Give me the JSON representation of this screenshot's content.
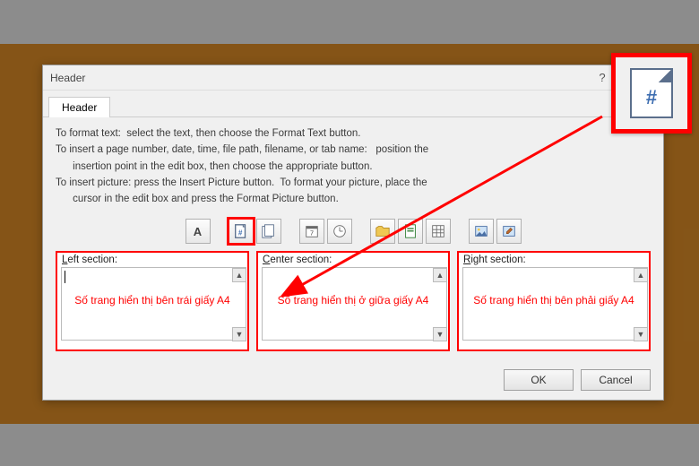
{
  "dialog": {
    "title": "Header",
    "tab": "Header",
    "help": "?",
    "close": "✕",
    "instructions": {
      "l1": "To format text:  select the text, then choose the Format Text button.",
      "l2": "To insert a page number, date, time, file path, filename, or tab name:   position the",
      "l3": "      insertion point in the edit box, then choose the appropriate button.",
      "l4": "To insert picture: press the Insert Picture button.  To format your picture, place the",
      "l5": "      cursor in the edit box and press the Format Picture button."
    },
    "toolbar": {
      "format_text": "A",
      "page_number": "page-number-icon",
      "pages": "pages-icon",
      "date": "date-icon",
      "time": "time-icon",
      "file_path": "file-path-icon",
      "file_name": "file-name-icon",
      "sheet_name": "sheet-name-icon",
      "insert_picture": "insert-picture-icon",
      "format_picture": "format-picture-icon"
    },
    "sections": {
      "left": {
        "label": "Left section:",
        "value": "",
        "annotation": "Số trang hiển thị bên trái giấy A4"
      },
      "center": {
        "label": "Center section:",
        "value": "",
        "annotation": "Số trang hiển thị ở giữa giấy A4"
      },
      "right": {
        "label": "Right section:",
        "value": "",
        "annotation": "Số trang hiển thị bên phải giấy A4"
      }
    },
    "buttons": {
      "ok": "OK",
      "cancel": "Cancel"
    }
  },
  "callout_icon": "#"
}
